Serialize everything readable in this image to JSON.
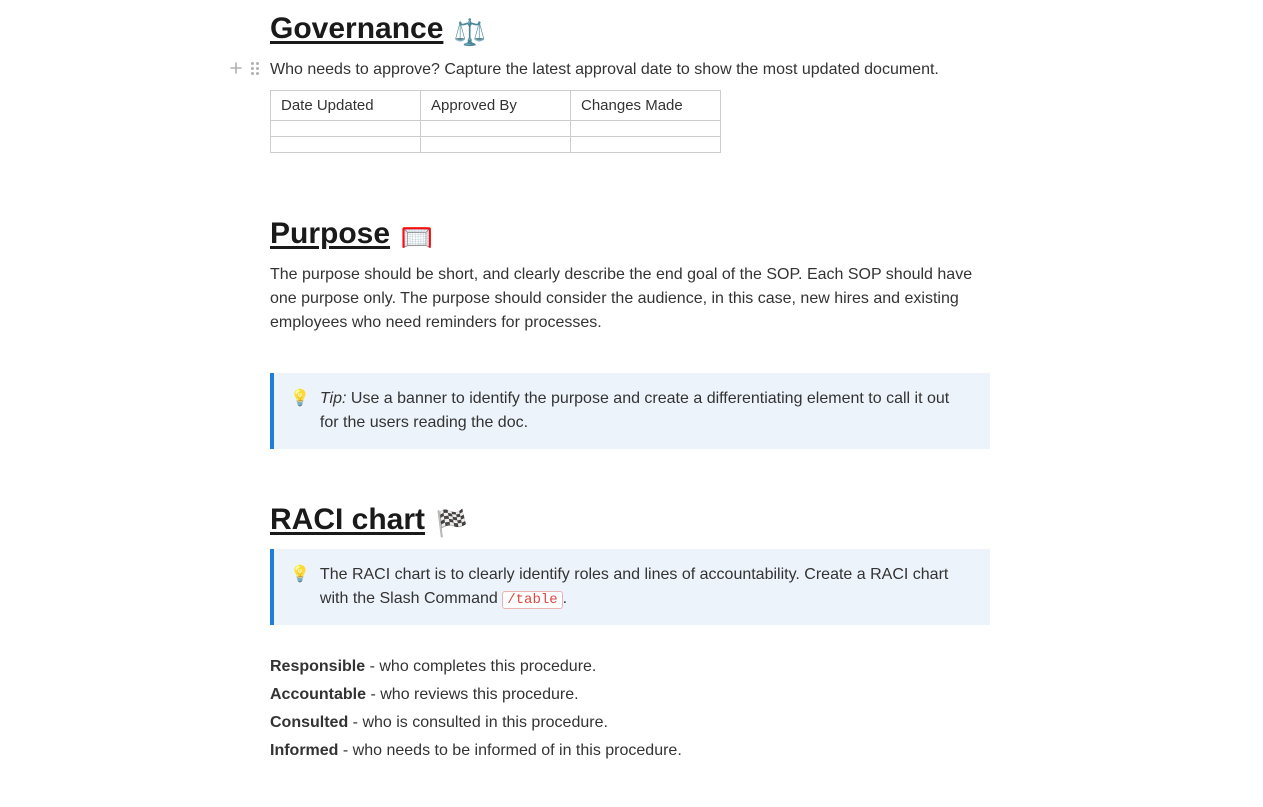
{
  "governance": {
    "heading": "Governance",
    "emoji": "⚖️",
    "intro": "Who needs to approve? Capture the latest approval date to show the most updated document.",
    "table": {
      "headers": [
        "Date Updated",
        "Approved By",
        "Changes Made"
      ],
      "rows": [
        [
          "",
          "",
          ""
        ],
        [
          "",
          "",
          ""
        ]
      ]
    }
  },
  "purpose": {
    "heading": "Purpose",
    "emoji": "🥅",
    "body": "The purpose should be short, and clearly describe the end goal of the SOP. Each SOP should have one purpose only. The purpose should consider the audience, in this case, new hires and existing employees who need reminders for processes.",
    "callout": {
      "bulb": "💡",
      "tip_label": "Tip:",
      "text": " Use a banner to identify the purpose and create a differentiating element to call it out for the users reading the doc."
    }
  },
  "raci": {
    "heading": "RACI chart",
    "emoji": "🏁",
    "callout": {
      "bulb": "💡",
      "text_before": "The RACI chart is to clearly identify roles and lines of accountability. Create a RACI chart with the Slash Command ",
      "code": "/table",
      "text_after": "."
    },
    "items": [
      {
        "term": "Responsible",
        "desc": " - who completes this procedure."
      },
      {
        "term": "Accountable",
        "desc": " - who reviews this procedure."
      },
      {
        "term": "Consulted",
        "desc": " - who is consulted in this procedure."
      },
      {
        "term": "Informed",
        "desc": " - who needs to be informed of in this procedure."
      }
    ]
  }
}
